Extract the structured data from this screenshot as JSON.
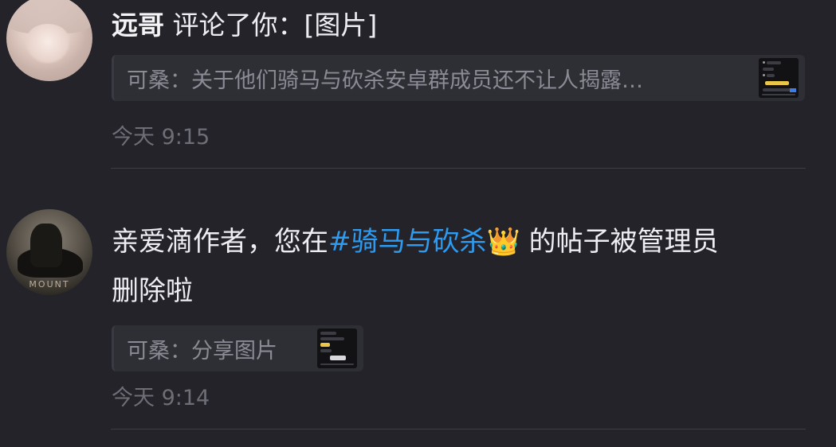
{
  "notifications": [
    {
      "author": "远哥",
      "action": " 评论了你：[图片]",
      "quote": "可桑：关于他们骑马与砍杀安卓群成员还不让人揭露…",
      "thumbnail_icon": "image-thumbnail",
      "time": "今天 9:15"
    },
    {
      "message_prefix": "亲爱滴作者，您在",
      "topic": "#骑马与砍杀",
      "crown": "👑",
      "message_suffix": " 的帖子被管理员",
      "message_line2": "删除啦",
      "quote": "可桑：分享图片",
      "thumbnail_icon": "image-thumbnail",
      "time": "今天 9:14"
    }
  ],
  "colors": {
    "background": "#232329",
    "topic_link": "#2f9bf0",
    "quote_bg": "#2e2e35",
    "muted_text": "#8b8b95",
    "time_text": "#6e6e78"
  }
}
